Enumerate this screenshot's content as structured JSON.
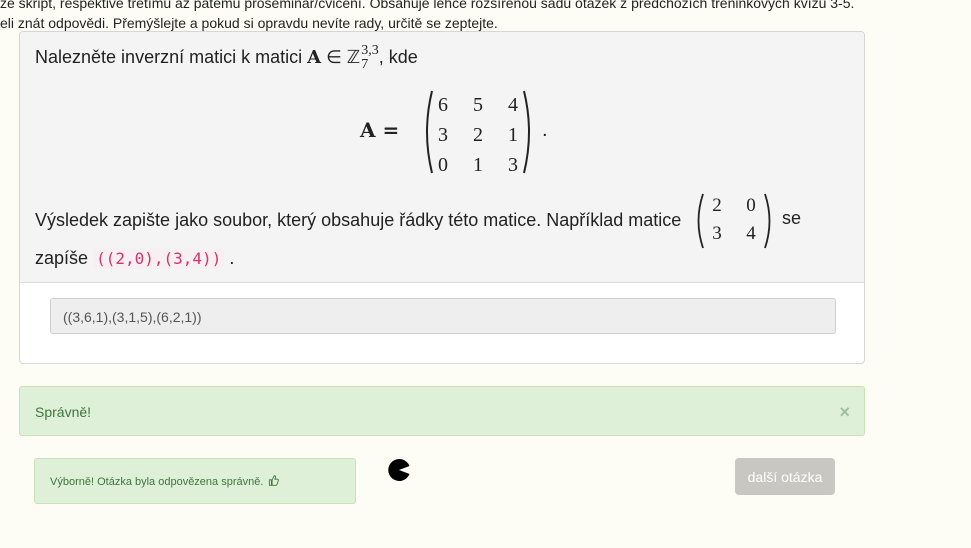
{
  "intro": {
    "line1": "ze skript, respektive třetímu až pátému proseminář/cvičení. Obsahuje lehce rozšířenou sadu otázek z předchozích tréninkových kvízů 3-5.",
    "line2": "eli znát odpovědi. Přemýšlejte a pokud si opravdu nevíte rady, určitě se zeptejte."
  },
  "question": {
    "prefix": "Nalezněte inverzní matici k matici ",
    "bold_symbol": "A",
    "in_symbol": "∈",
    "ring": "ℤ",
    "superscript": "3,3",
    "subscript": "7",
    "suffix": ", kde",
    "lhs": "A =",
    "matrix": [
      [
        "6",
        "5",
        "4"
      ],
      [
        "3",
        "2",
        "1"
      ],
      [
        "0",
        "1",
        "3"
      ]
    ],
    "end_dot": ".",
    "result_text": "Výsledek zapište jako soubor, který obsahuje řádky této matice. Například matice",
    "example_matrix": [
      [
        "2",
        "0"
      ],
      [
        "3",
        "4"
      ]
    ],
    "se": "se",
    "zapise": "zapíše",
    "example_code": "((2,0),(3,4))",
    "zapise_dot": "."
  },
  "answer": {
    "value": "((3,6,1),(3,1,5),(6,2,1))"
  },
  "alert": {
    "text": "Správně!",
    "close": "×"
  },
  "feedback": {
    "text": "Výborně! Otázka byla odpovězena správně.",
    "icon": "thumbs-up-icon"
  },
  "next_button": {
    "label": "další otázka"
  },
  "colors": {
    "success_bg": "#dff0d8",
    "success_text": "#3c763d",
    "code": "#d6336c",
    "button_disabled": "#c9c7c2"
  }
}
